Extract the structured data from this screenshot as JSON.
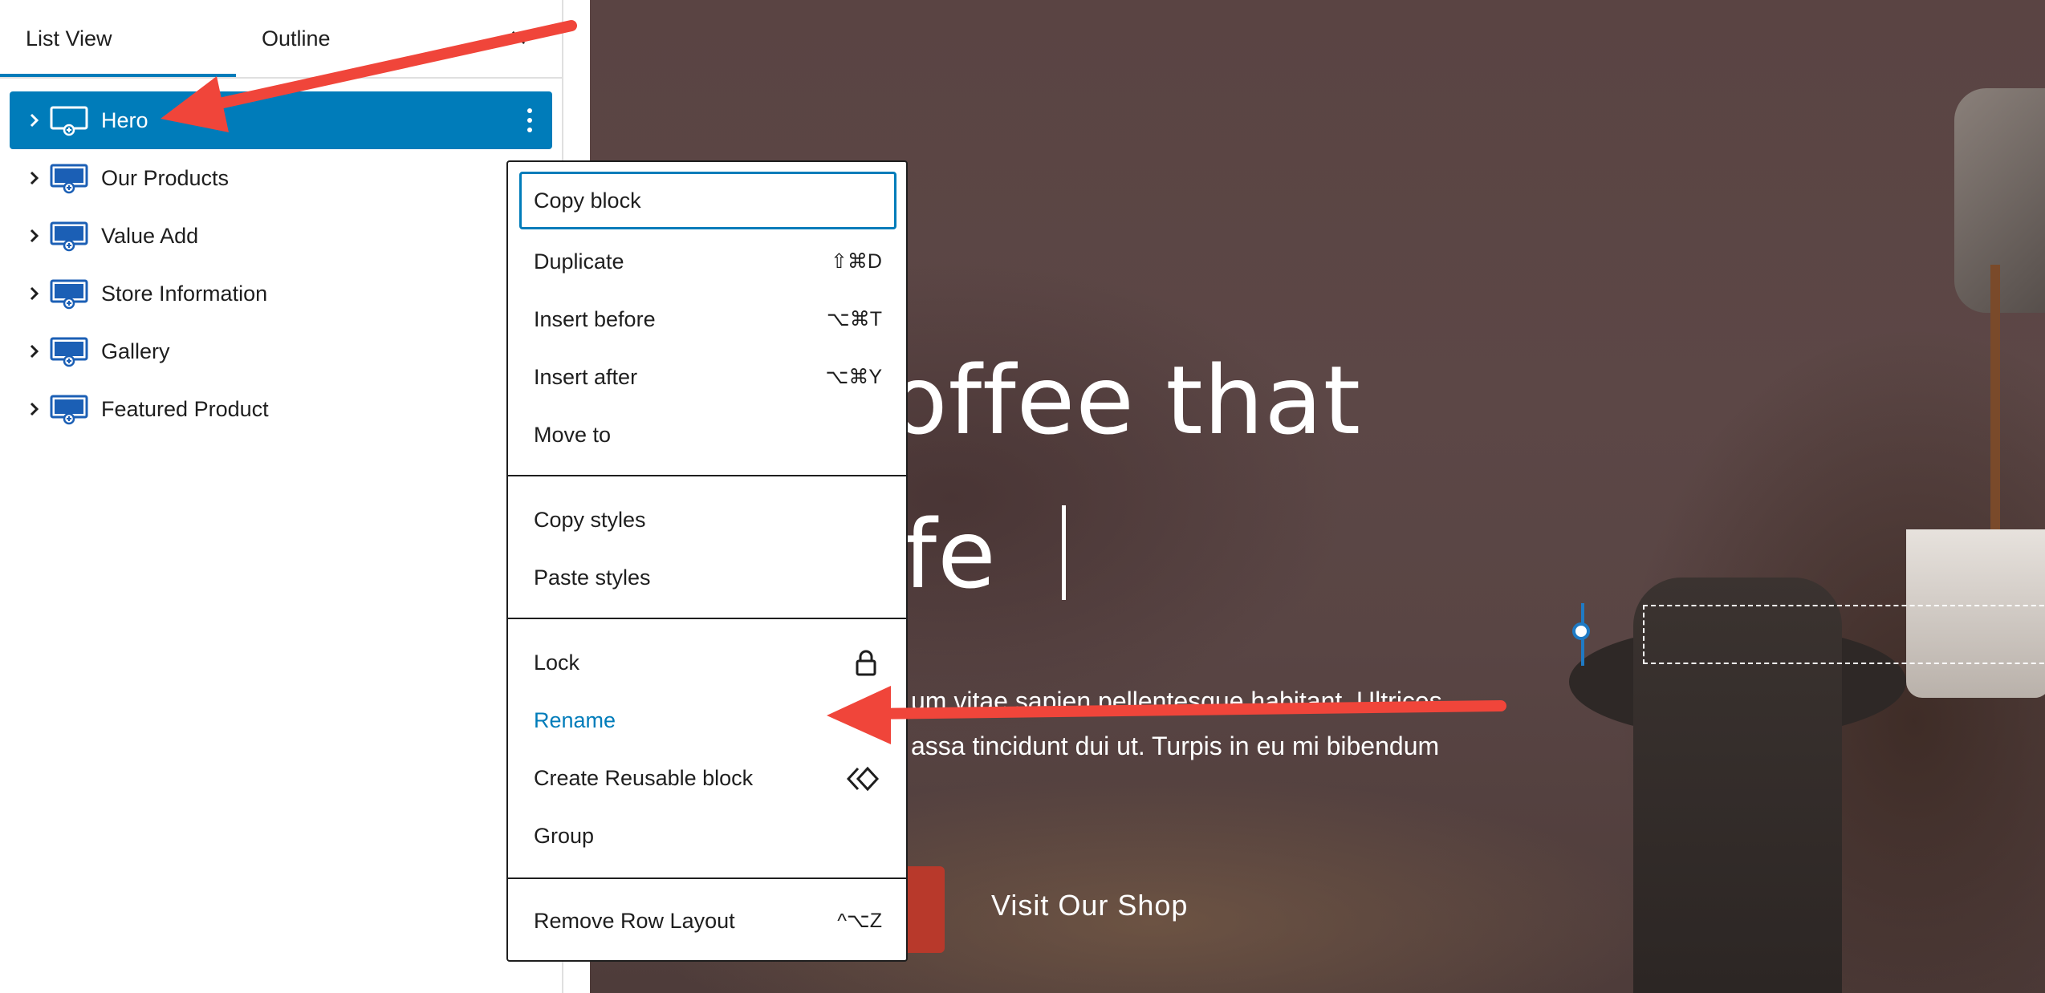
{
  "sidebar": {
    "tabs": [
      {
        "label": "List View",
        "active": true
      },
      {
        "label": "Outline",
        "active": false
      }
    ],
    "close_label": "×",
    "items": [
      {
        "label": "Hero",
        "selected": true
      },
      {
        "label": "Our Products",
        "selected": false
      },
      {
        "label": "Value Add",
        "selected": false
      },
      {
        "label": "Store Information",
        "selected": false
      },
      {
        "label": "Gallery",
        "selected": false
      },
      {
        "label": "Featured Product",
        "selected": false
      }
    ]
  },
  "context_menu": {
    "group1": [
      {
        "label": "Copy block",
        "shortcut": ""
      },
      {
        "label": "Duplicate",
        "shortcut": "⇧⌘D"
      },
      {
        "label": "Insert before",
        "shortcut": "⌥⌘T"
      },
      {
        "label": "Insert after",
        "shortcut": "⌥⌘Y"
      },
      {
        "label": "Move to",
        "shortcut": ""
      }
    ],
    "group2": [
      {
        "label": "Copy styles"
      },
      {
        "label": "Paste styles"
      }
    ],
    "group3": [
      {
        "label": "Lock",
        "icon": "lock-icon"
      },
      {
        "label": "Rename"
      },
      {
        "label": "Create Reusable block",
        "icon": "reusable-block-icon"
      },
      {
        "label": "Group"
      }
    ],
    "group4": [
      {
        "label": "Remove Row Layout",
        "shortcut": "^⌥Z"
      }
    ]
  },
  "hero": {
    "title_line1": "Coffee that",
    "title_line2": "Life",
    "text_line1": "um vitae sapien pellentesque habitant. Ultrices",
    "text_line2": "assa tincidunt dui ut. Turpis in eu mi bibendum",
    "secondary_button": "Visit Our Shop"
  },
  "colors": {
    "accent": "#007cba",
    "annotation_arrow": "#f0453a",
    "primary_button": "#b8392b"
  }
}
